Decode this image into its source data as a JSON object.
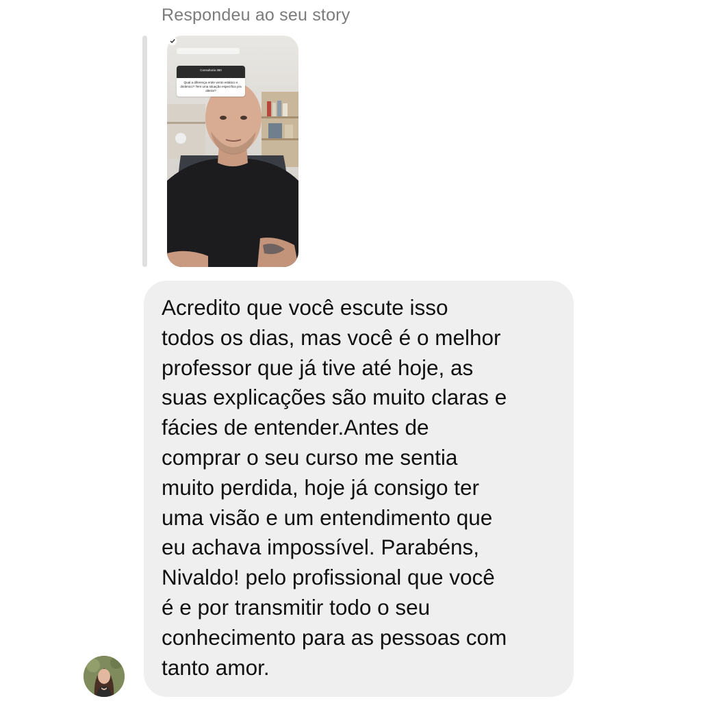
{
  "thread": {
    "reply_caption": "Respondeu ao seu story",
    "story": {
      "question_header": "Consultoria 360",
      "question_text": "Qual a diferença entre vento estático e dinâmico? Tem uma situação específica pra alterar?",
      "check_icon": "check-badge-icon"
    },
    "message": {
      "text": "Acredito que você escute isso\ntodos os dias, mas você é o melhor\nprofessor que já tive até hoje, as\nsuas explicações são muito claras e\nfácies de entender.Antes de\ncomprar o seu curso me sentia\nmuito perdida, hoje já consigo ter\numa visão e um entendimento que\neu achava impossível.  Parabéns,\nNivaldo! pelo profissional que você\né e por transmitir todo o seu\nconhecimento para as pessoas com\ntanto amor."
    },
    "sender": {
      "avatar_icon": "user-avatar"
    }
  },
  "colors": {
    "bubble": "#efefef",
    "caption": "#7c7c7c",
    "quote_bar": "#e0e0e0",
    "text": "#111111"
  }
}
